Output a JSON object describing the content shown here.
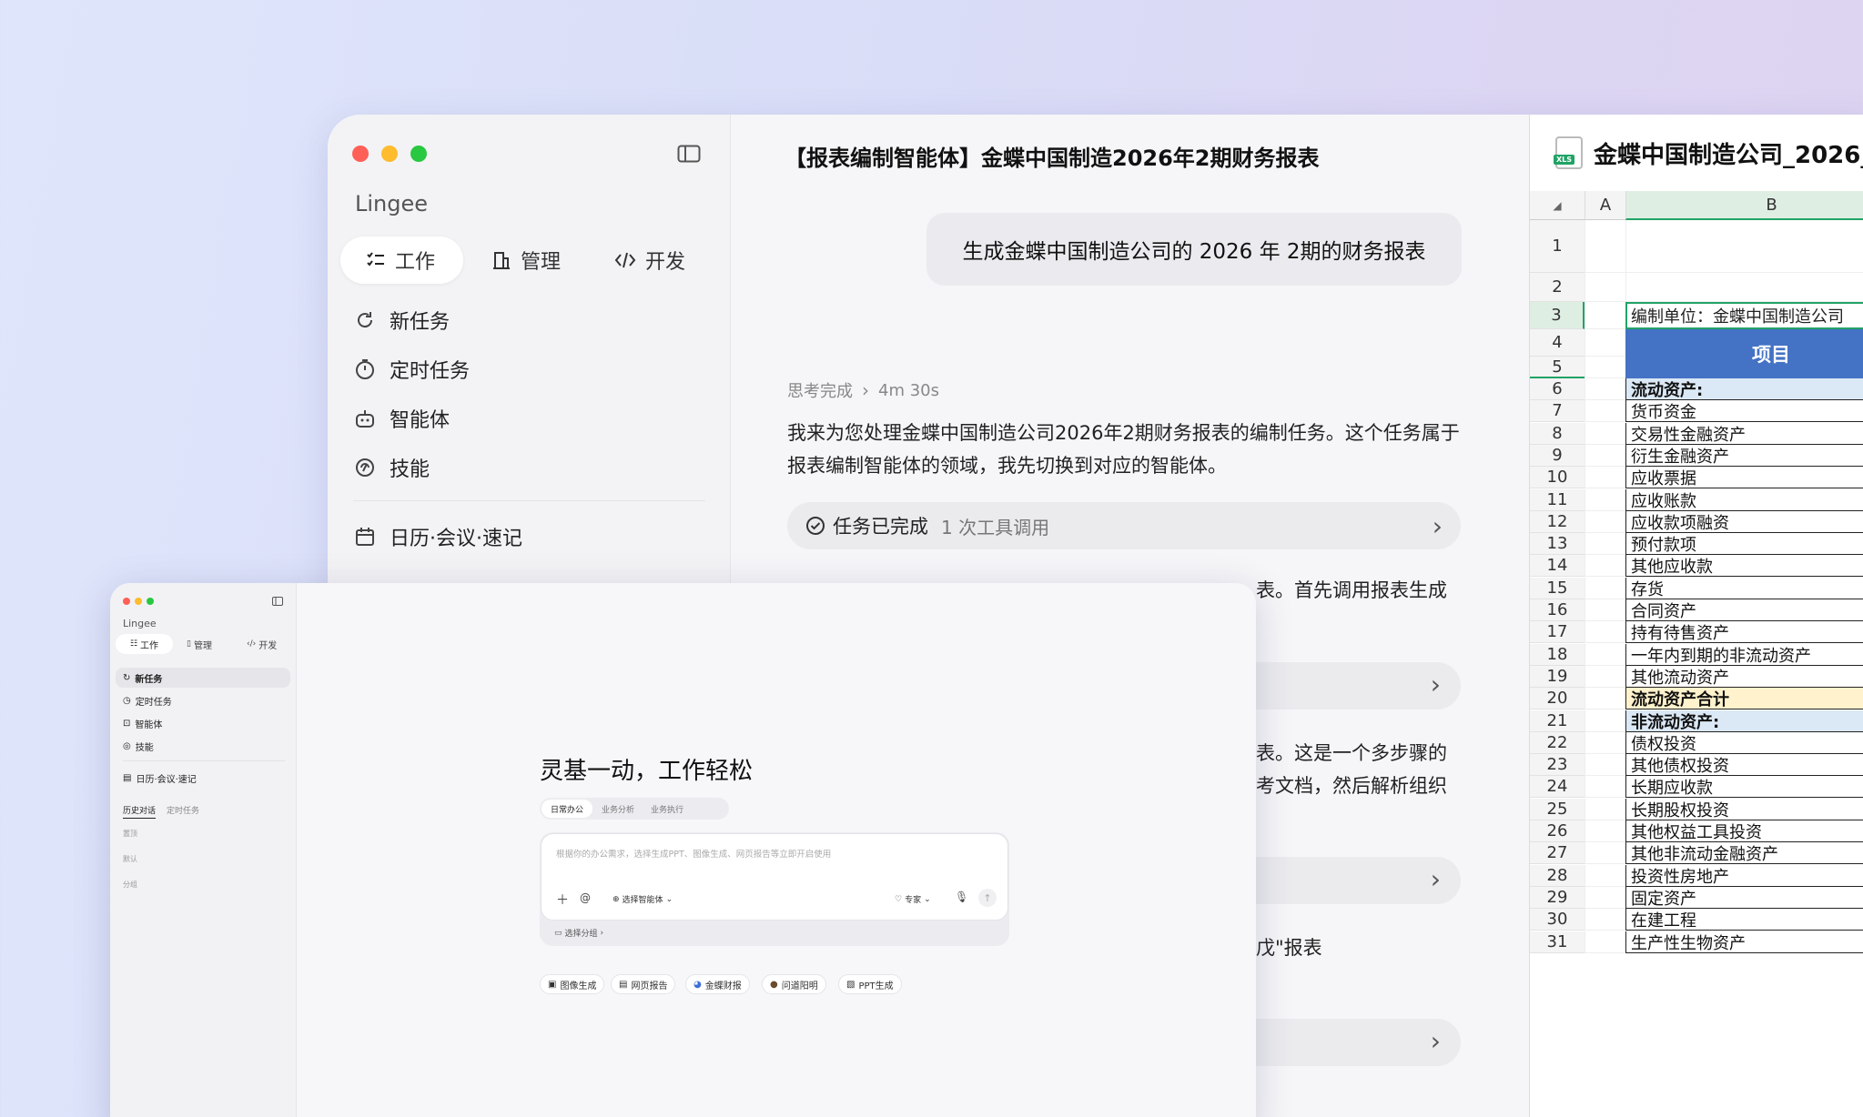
{
  "colors": {
    "accent_blue": "#4472c4",
    "section_blue": "#dbe8f5",
    "total_yellow": "#fff2cc",
    "excel_green": "#21a366"
  },
  "back_window": {
    "sidebar": {
      "app_name": "Lingee",
      "tabs": [
        {
          "label": "工作",
          "icon": "list-check-icon"
        },
        {
          "label": "管理",
          "icon": "building-icon"
        },
        {
          "label": "开发",
          "icon": "code-icon"
        }
      ],
      "menu": [
        {
          "label": "新任务",
          "icon": "refresh-plus-icon"
        },
        {
          "label": "定时任务",
          "icon": "timer-icon"
        },
        {
          "label": "智能体",
          "icon": "robot-icon"
        },
        {
          "label": "技能",
          "icon": "skill-icon"
        },
        {
          "label": "日历·会议·速记",
          "icon": "calendar-icon"
        }
      ]
    },
    "chat": {
      "title": "【报表编制智能体】金蝶中国制造2026年2期财务报表",
      "user_message": "生成金蝶中国制造公司的 2026 年 2期的财务报表",
      "thinking_label": "思考完成",
      "thinking_time": "4m 30s",
      "reply_1": "我来为您处理金蝶中国制造公司2026年2期财务报表的编制任务。这个任务属于报表编制智能体的领域，我先切换到对应的智能体。",
      "task_status": "任务已完成",
      "tool_calls": "1 次工具调用",
      "reply_2_tail": "表。首先调用报表生成",
      "reply_3_line1_tail": "表。这是一个多步骤的",
      "reply_3_line2_tail": "考文档，然后解析组织",
      "reply_4_tail": "戊\"报表"
    }
  },
  "sheet": {
    "file_name": "金蝶中国制造公司_2026_",
    "file_badge": "XLS",
    "col_a": "A",
    "col_b": "B",
    "unit_label": "编制单位：金蝶中国制造公司",
    "header_label": "项目",
    "rows": [
      {
        "n": "6",
        "text": "流动资产:",
        "kind": "section"
      },
      {
        "n": "7",
        "text": "货币资金",
        "kind": "item"
      },
      {
        "n": "8",
        "text": "交易性金融资产",
        "kind": "item"
      },
      {
        "n": "9",
        "text": "衍生金融资产",
        "kind": "item"
      },
      {
        "n": "10",
        "text": "应收票据",
        "kind": "item"
      },
      {
        "n": "11",
        "text": "应收账款",
        "kind": "item"
      },
      {
        "n": "12",
        "text": "应收款项融资",
        "kind": "item"
      },
      {
        "n": "13",
        "text": "预付款项",
        "kind": "item"
      },
      {
        "n": "14",
        "text": "其他应收款",
        "kind": "item"
      },
      {
        "n": "15",
        "text": "存货",
        "kind": "item"
      },
      {
        "n": "16",
        "text": "合同资产",
        "kind": "item"
      },
      {
        "n": "17",
        "text": "持有待售资产",
        "kind": "item"
      },
      {
        "n": "18",
        "text": "一年内到期的非流动资产",
        "kind": "item"
      },
      {
        "n": "19",
        "text": "其他流动资产",
        "kind": "item"
      },
      {
        "n": "20",
        "text": "流动资产合计",
        "kind": "total"
      },
      {
        "n": "21",
        "text": "非流动资产:",
        "kind": "section"
      },
      {
        "n": "22",
        "text": "债权投资",
        "kind": "item"
      },
      {
        "n": "23",
        "text": "其他债权投资",
        "kind": "item"
      },
      {
        "n": "24",
        "text": "长期应收款",
        "kind": "item"
      },
      {
        "n": "25",
        "text": "长期股权投资",
        "kind": "item"
      },
      {
        "n": "26",
        "text": "其他权益工具投资",
        "kind": "item"
      },
      {
        "n": "27",
        "text": "其他非流动金融资产",
        "kind": "item"
      },
      {
        "n": "28",
        "text": "投资性房地产",
        "kind": "item"
      },
      {
        "n": "29",
        "text": "固定资产",
        "kind": "item"
      },
      {
        "n": "30",
        "text": "在建工程",
        "kind": "item"
      },
      {
        "n": "31",
        "text": "生产性生物资产",
        "kind": "item"
      }
    ]
  },
  "front_window": {
    "sidebar": {
      "app_name": "Lingee",
      "tabs": [
        "工作",
        "管理",
        "开发"
      ],
      "menu": [
        {
          "label": "新任务",
          "icon": "refresh-plus-icon"
        },
        {
          "label": "定时任务",
          "icon": "timer-icon"
        },
        {
          "label": "智能体",
          "icon": "robot-icon"
        },
        {
          "label": "技能",
          "icon": "skill-icon"
        },
        {
          "label": "日历·会议·速记",
          "icon": "calendar-icon"
        }
      ],
      "history_tabs": [
        "历史对话",
        "定时任务"
      ],
      "groups": [
        "置顶",
        "默认",
        "分组"
      ]
    },
    "main": {
      "hero_title": "灵基一动，工作轻松",
      "mode_tabs": [
        "日常办公",
        "业务分析",
        "业务执行"
      ],
      "input_placeholder": "根据你的办公需求，选择生成PPT、图像生成、网页报告等立即开启使用",
      "select_agent": "选择智能体",
      "expert": "专家",
      "select_group": "选择分组",
      "chips": [
        {
          "label": "图像生成",
          "icon": "image-icon"
        },
        {
          "label": "网页报告",
          "icon": "web-report-icon"
        },
        {
          "label": "金蝶财报",
          "icon": "kingdee-icon"
        },
        {
          "label": "问道阳明",
          "icon": "avatar-icon"
        },
        {
          "label": "PPT生成",
          "icon": "ppt-icon"
        }
      ]
    }
  }
}
